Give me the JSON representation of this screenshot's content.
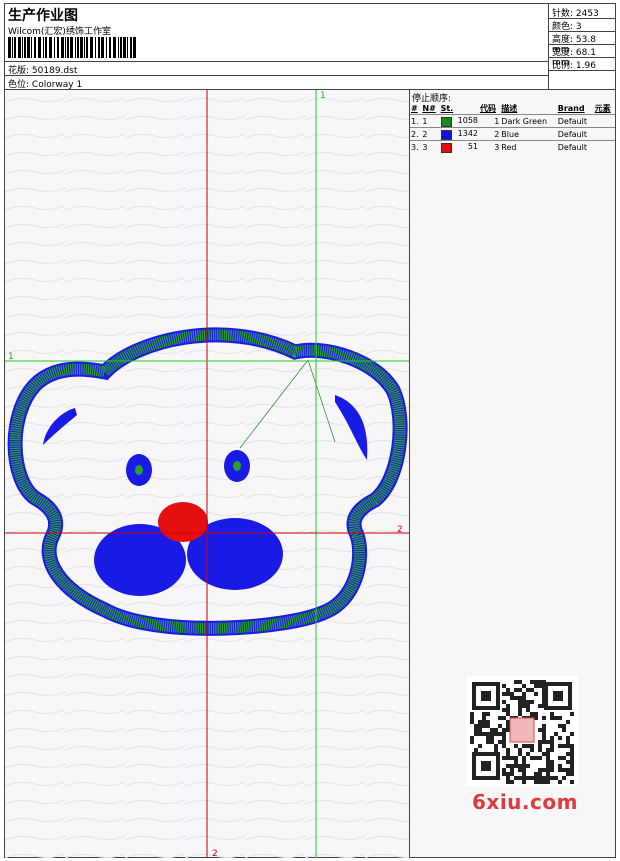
{
  "header": {
    "title": "生产作业图",
    "company": "Wilcom(汇宏)绣饰工作室",
    "design_label": "花版:",
    "design_file": "50189.dst",
    "colorway_label": "色位:",
    "colorway": "Colorway 1"
  },
  "stats": [
    {
      "label": "针数:",
      "value": "2453"
    },
    {
      "label": "颜色:",
      "value": "3"
    },
    {
      "label": "高度:",
      "value": "53.8 mm"
    },
    {
      "label": "宽度:",
      "value": "68.1 mm"
    },
    {
      "label": "比例:",
      "value": "1.96"
    }
  ],
  "stop_sequence": {
    "title": "停止顺序:",
    "columns": [
      "#",
      "N#",
      "St.",
      "代码",
      "描述",
      "Brand",
      "元素"
    ],
    "rows": [
      {
        "index": "1.",
        "n": "1",
        "stitches": "1058",
        "code": "1",
        "description": "Dark Green",
        "brand": "Default",
        "color": "#1a8a1a"
      },
      {
        "index": "2.",
        "n": "2",
        "stitches": "1342",
        "code": "2",
        "description": "Blue",
        "brand": "Default",
        "color": "#1010e0"
      },
      {
        "index": "3.",
        "n": "3",
        "stitches": "51",
        "code": "3",
        "description": "Red",
        "brand": "Default",
        "color": "#e01010"
      }
    ]
  },
  "axes": {
    "vertical_top": "1",
    "vertical_bottom": "2",
    "horizontal_left": "1",
    "horizontal_right": "2"
  },
  "watermark": "6xiu.com",
  "colors": {
    "green": "#2ca02c",
    "blue": "#1a1ae6",
    "red": "#e41010",
    "axis_red": "#d00000",
    "axis_green": "#22cc22"
  }
}
